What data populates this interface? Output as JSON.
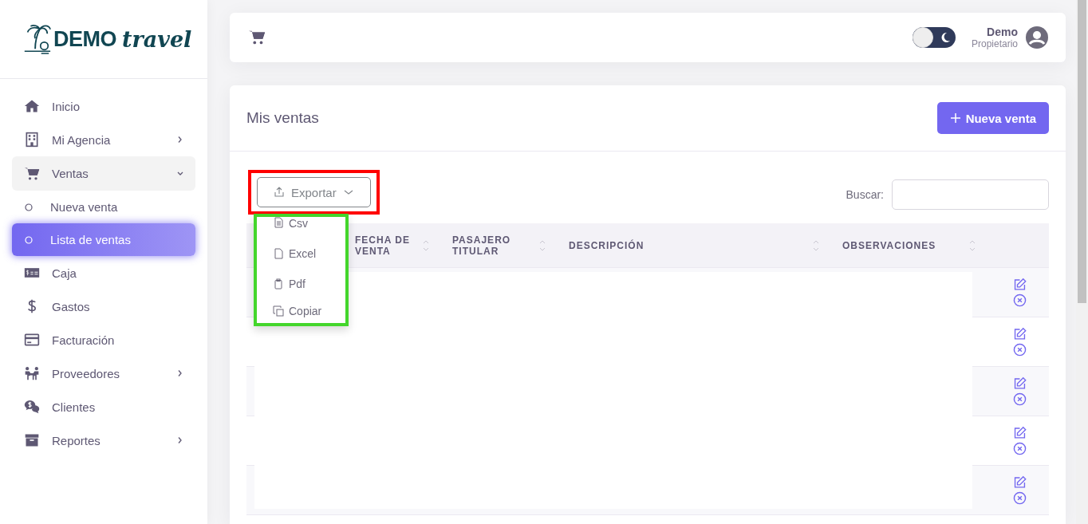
{
  "logo": {
    "brand": "DEMO",
    "tagline": "travel"
  },
  "sidebar": {
    "items": [
      {
        "label": "Inicio",
        "has_submenu": false
      },
      {
        "label": "Mi Agencia",
        "has_submenu": true,
        "expanded": false
      },
      {
        "label": "Ventas",
        "has_submenu": true,
        "expanded": true,
        "children": [
          {
            "label": "Nueva venta",
            "selected": false
          },
          {
            "label": "Lista de ventas",
            "selected": true
          }
        ]
      },
      {
        "label": "Caja",
        "has_submenu": false
      },
      {
        "label": "Gastos",
        "has_submenu": false
      },
      {
        "label": "Facturación",
        "has_submenu": false
      },
      {
        "label": "Proveedores",
        "has_submenu": true,
        "expanded": false
      },
      {
        "label": "Clientes",
        "has_submenu": false
      },
      {
        "label": "Reportes",
        "has_submenu": true,
        "expanded": false
      }
    ]
  },
  "header": {
    "dark_mode": false,
    "user": {
      "name": "Demo",
      "role": "Propietario"
    }
  },
  "page": {
    "title": "Mis ventas",
    "new_button": "Nueva venta",
    "export": {
      "label": "Exportar",
      "open": true,
      "highlighted": true,
      "menu": {
        "highlighted": true,
        "items": [
          {
            "label": "Csv"
          },
          {
            "label": "Excel"
          },
          {
            "label": "Pdf"
          },
          {
            "label": "Copiar"
          }
        ]
      }
    },
    "search": {
      "label": "Buscar:"
    },
    "table": {
      "columns": [
        {
          "label": "FECHA DE VENTA",
          "sortable": true
        },
        {
          "label": "PASAJERO TITULAR",
          "sortable": true
        },
        {
          "label": "DESCRIPCIÓN",
          "sortable": true
        },
        {
          "label": "OBSERVACIONES",
          "sortable": true
        }
      ],
      "rows": [
        {
          "actions": [
            {
              "kind": "edit"
            },
            {
              "kind": "cancel"
            }
          ]
        },
        {
          "actions": [
            {
              "kind": "edit"
            },
            {
              "kind": "cancel"
            }
          ]
        },
        {
          "actions": [
            {
              "kind": "edit"
            },
            {
              "kind": "cancel"
            }
          ]
        },
        {
          "actions": [
            {
              "kind": "edit"
            },
            {
              "kind": "cancel"
            }
          ]
        },
        {
          "actions": [
            {
              "kind": "edit"
            },
            {
              "kind": "cancel"
            }
          ]
        }
      ]
    }
  }
}
